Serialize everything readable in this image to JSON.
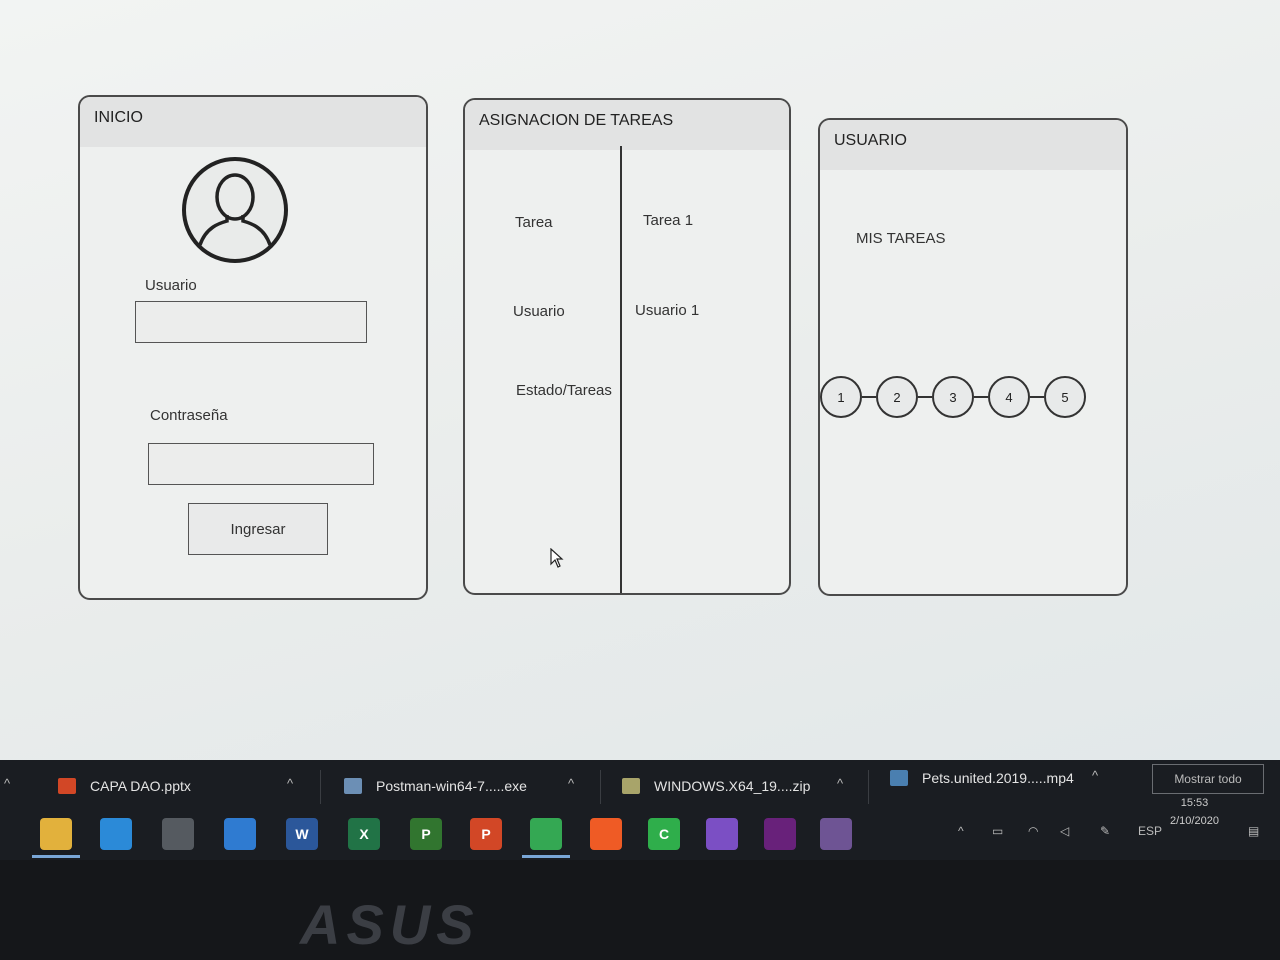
{
  "panels": {
    "login": {
      "title": "INICIO",
      "user_label": "Usuario",
      "user_value": "",
      "password_label": "Contraseña",
      "password_value": "",
      "submit_label": "Ingresar"
    },
    "assign": {
      "title": "ASIGNACION DE TAREAS",
      "rows": [
        {
          "label": "Tarea",
          "value": "Tarea 1"
        },
        {
          "label": "Usuario",
          "value": "Usuario 1"
        },
        {
          "label": "Estado/Tareas",
          "value": ""
        }
      ]
    },
    "user": {
      "title": "USUARIO",
      "section": "MIS TAREAS",
      "steps": [
        "1",
        "2",
        "3",
        "4",
        "5"
      ]
    }
  },
  "taskbar": {
    "downloads": [
      {
        "name": "CAPA DAO.pptx",
        "icon": "powerpoint-file-icon"
      },
      {
        "name": "Postman-win64-7.....exe",
        "icon": "exe-file-icon"
      },
      {
        "name": "WINDOWS.X64_19....zip",
        "icon": "zip-file-icon"
      },
      {
        "name": "Pets.united.2019.....mp4",
        "icon": "video-file-icon"
      }
    ],
    "show_all": "Mostrar todo",
    "apps": [
      {
        "name": "file-explorer-icon",
        "glyph": "",
        "color": "#e2b13c"
      },
      {
        "name": "edge-icon",
        "glyph": "",
        "color": "#2b8ad8"
      },
      {
        "name": "store-icon",
        "glyph": "",
        "color": "#555a60"
      },
      {
        "name": "mail-icon",
        "glyph": "",
        "color": "#2f7bd1"
      },
      {
        "name": "word-icon",
        "glyph": "W",
        "color": "#2b579a"
      },
      {
        "name": "excel-icon",
        "glyph": "X",
        "color": "#217346"
      },
      {
        "name": "project-icon",
        "glyph": "P",
        "color": "#31752f"
      },
      {
        "name": "powerpoint-icon",
        "glyph": "P",
        "color": "#d24726"
      },
      {
        "name": "chrome-icon",
        "glyph": "",
        "color": "#34a853"
      },
      {
        "name": "postman-icon",
        "glyph": "",
        "color": "#ef5b25"
      },
      {
        "name": "camtasia-icon",
        "glyph": "C",
        "color": "#2fae4b"
      },
      {
        "name": "visual-studio-icon",
        "glyph": "",
        "color": "#7b4fc4"
      },
      {
        "name": "visual-studio-2-icon",
        "glyph": "",
        "color": "#68217a"
      },
      {
        "name": "github-icon",
        "glyph": "",
        "color": "#6e5494"
      }
    ],
    "tray": {
      "lang": "ESP",
      "time": "15:53",
      "date": "2/10/2020"
    }
  },
  "brand": "ASUS"
}
